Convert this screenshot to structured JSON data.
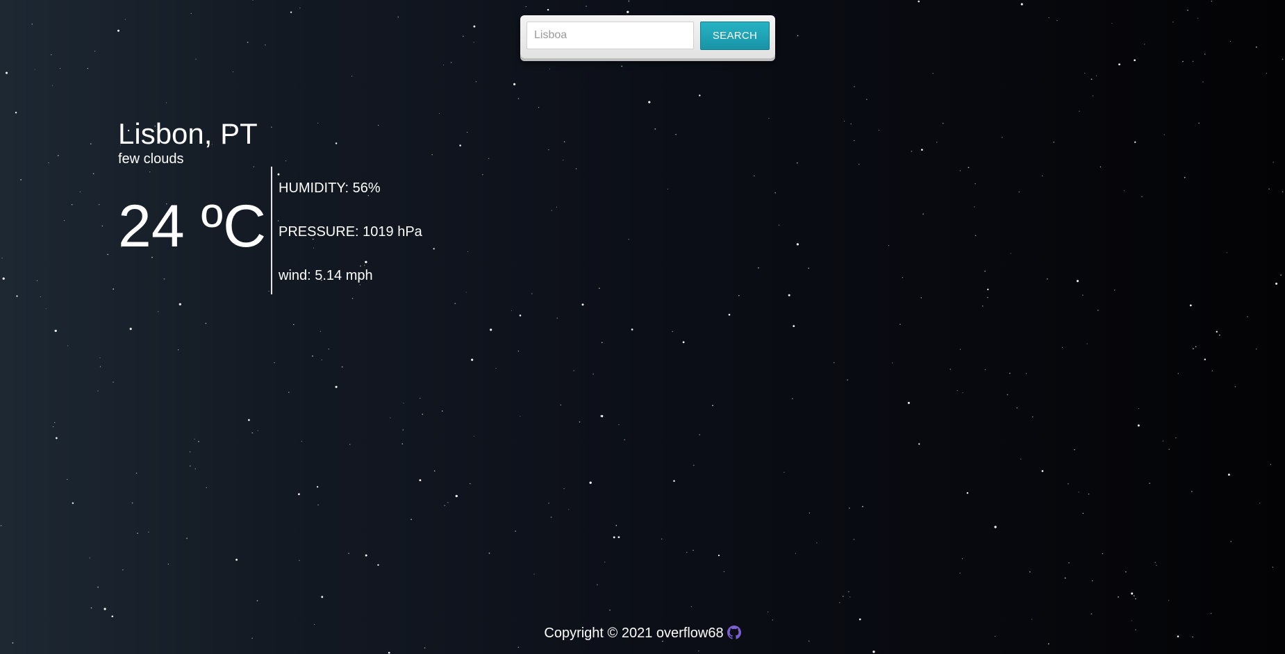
{
  "search": {
    "placeholder": "Lisboa",
    "value": "",
    "button_label": "SEARCH"
  },
  "weather": {
    "location": "Lisbon, PT",
    "description": "few clouds",
    "temperature": "24 ºC",
    "humidity": "HUMIDITY: 56%",
    "pressure": "PRESSURE: 1019 hPa",
    "wind": "wind: 5.14 mph"
  },
  "footer": {
    "copyright": "Copyright © 2021 overflow68",
    "icon": "github-icon"
  },
  "colors": {
    "accent": "#1fa3b5",
    "text": "#ffffff",
    "background_dark": "#030305",
    "background_light": "#1d2833",
    "github_icon": "#7a5fd0"
  }
}
